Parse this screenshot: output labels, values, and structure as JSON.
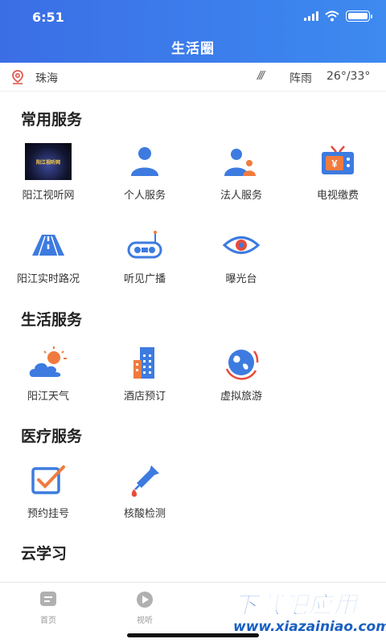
{
  "status": {
    "time": "6:51"
  },
  "header": {
    "title": "生活圈"
  },
  "location": {
    "city": "珠海",
    "weather_icon": "///",
    "condition": "阵雨",
    "temperature": "26°/33°"
  },
  "sections": {
    "common": {
      "title": "常用服务",
      "items": [
        {
          "label": "阳江视听网",
          "logo_text": "阳江视听网"
        },
        {
          "label": "个人服务"
        },
        {
          "label": "法人服务"
        },
        {
          "label": "电视缴费",
          "icon_text": "¥"
        },
        {
          "label": "阳江实时路况"
        },
        {
          "label": "听见广播"
        },
        {
          "label": "曝光台"
        }
      ]
    },
    "life": {
      "title": "生活服务",
      "items": [
        {
          "label": "阳江天气"
        },
        {
          "label": "酒店预订"
        },
        {
          "label": "虚拟旅游"
        }
      ]
    },
    "medical": {
      "title": "医疗服务",
      "items": [
        {
          "label": "预约挂号"
        },
        {
          "label": "核酸检测"
        }
      ]
    },
    "cloud": {
      "title": "云学习"
    }
  },
  "tabbar": {
    "tabs": [
      {
        "label": "首页"
      },
      {
        "label": "视听"
      }
    ]
  },
  "watermark": {
    "main": "下载吧应用",
    "sub": "www.xiazainiao.com"
  },
  "colors": {
    "blue": "#3d7be0",
    "orange": "#f07b3f",
    "red": "#e74c3c"
  }
}
